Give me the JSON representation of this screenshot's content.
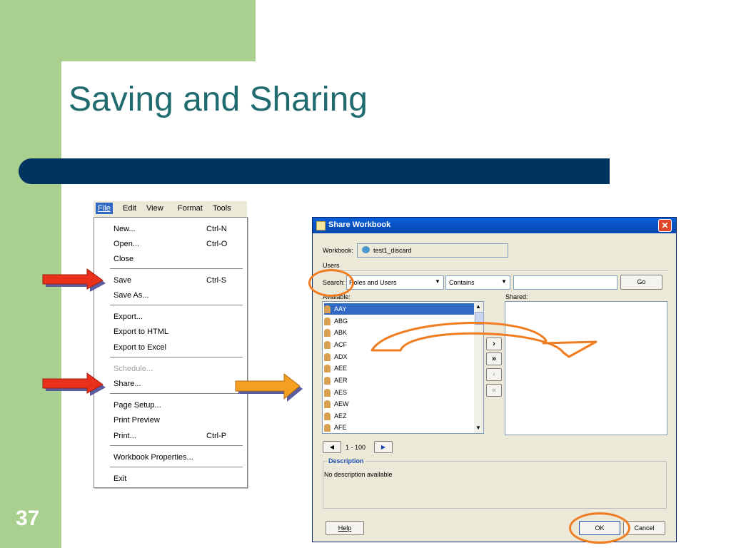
{
  "slide": {
    "title": "Saving and Sharing",
    "number": "37"
  },
  "menubar": {
    "items": [
      "File",
      "Edit",
      "View",
      "Format",
      "Tools"
    ]
  },
  "file_menu": {
    "items": [
      {
        "label": "New...",
        "shortcut": "Ctrl-N"
      },
      {
        "label": "Open...",
        "shortcut": "Ctrl-O"
      },
      {
        "label": "Close",
        "shortcut": ""
      },
      {
        "label": "Save",
        "shortcut": "Ctrl-S"
      },
      {
        "label": "Save As...",
        "shortcut": ""
      },
      {
        "label": "Export...",
        "shortcut": ""
      },
      {
        "label": "Export to HTML",
        "shortcut": ""
      },
      {
        "label": "Export to Excel",
        "shortcut": ""
      },
      {
        "label": "Schedule...",
        "shortcut": ""
      },
      {
        "label": "Share...",
        "shortcut": ""
      },
      {
        "label": "Page Setup...",
        "shortcut": ""
      },
      {
        "label": "Print Preview",
        "shortcut": ""
      },
      {
        "label": "Print...",
        "shortcut": "Ctrl-P"
      },
      {
        "label": "Workbook Properties...",
        "shortcut": ""
      },
      {
        "label": "Exit",
        "shortcut": ""
      }
    ]
  },
  "dialog": {
    "title": "Share Workbook",
    "workbook_label": "Workbook:",
    "workbook_value": "test1_discard",
    "users_section": "Users",
    "search_label": "Search:",
    "search_scope": "Roles and Users",
    "search_operator": "Contains",
    "search_value": "",
    "go_button": "Go",
    "available_label": "Available:",
    "shared_label": "Shared:",
    "available_users": [
      "AAY",
      "ABG",
      "ABK",
      "ACF",
      "ADX",
      "AEE",
      "AER",
      "AES",
      "AEW",
      "AEZ",
      "AFE"
    ],
    "selected_user": "AAY",
    "paging": "1 - 100",
    "description_title": "Description",
    "description_text": "No description available",
    "help_button": "Help",
    "ok_button": "OK",
    "cancel_button": "Cancel"
  },
  "colors": {
    "green": "#a9d08e",
    "navy": "#003360",
    "title": "#1f6b70",
    "red_arrow": "#e8301a",
    "orange_arrow": "#f5a020",
    "highlight": "#f07c20"
  }
}
